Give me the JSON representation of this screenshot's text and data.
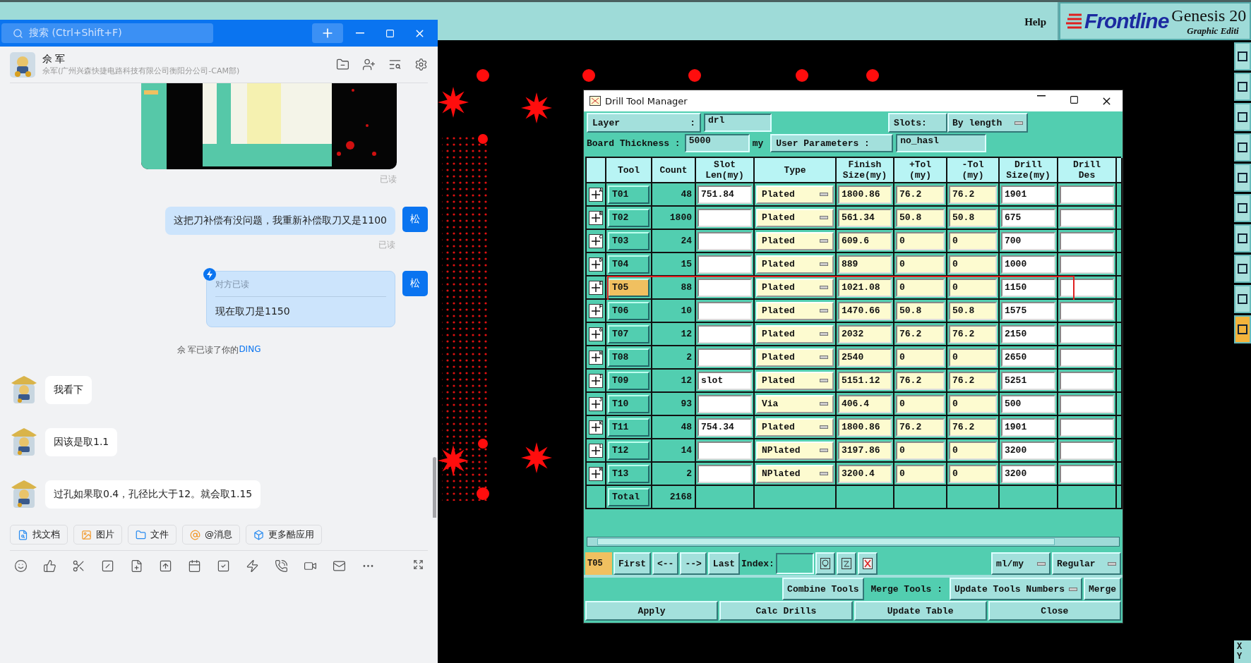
{
  "app_menu": {
    "help": "Help",
    "logo": "Frontline",
    "product": "Genesis 20",
    "subtitle": "Graphic Editi"
  },
  "right_toolbar": {
    "coords": [
      "X",
      "Y"
    ]
  },
  "chat": {
    "search": {
      "placeholder": "搜索 (Ctrl+Shift+F)"
    },
    "contact": {
      "name": "佘 军",
      "detail": "佘军(广州兴森快捷电路科技有限公司衡阳分公司-CAM部)"
    },
    "messages": [
      {
        "kind": "picture",
        "receipt": "已读"
      },
      {
        "kind": "outgoing",
        "text": "这把刀补偿有没问题，我重新补偿取刀又是1100",
        "avatar": "松",
        "receipt": "已读"
      },
      {
        "kind": "ding",
        "status": "对方已读",
        "text": "现在取刀是1150",
        "avatar": "松"
      },
      {
        "kind": "system",
        "text": "佘 军已读了你的",
        "link": "DING"
      },
      {
        "kind": "incoming",
        "text": "我看下"
      },
      {
        "kind": "incoming",
        "text": "因该是取1.1"
      },
      {
        "kind": "incoming",
        "text": "过孔如果取0.4，孔径比大于12。就会取1.15"
      }
    ],
    "quick_actions": [
      "找文档",
      "图片",
      "文件",
      "@消息",
      "更多酷应用"
    ]
  },
  "drill_manager": {
    "title": "Drill Tool Manager",
    "layer": {
      "label": "Layer",
      "colon": ":",
      "value": "drl"
    },
    "slots": {
      "label": "Slots:",
      "value": "By length"
    },
    "thickness": {
      "label": "Board Thickness :",
      "value": "5000",
      "unit": "my"
    },
    "user_params": {
      "label": "User Parameters :",
      "value": "no_hasl"
    },
    "columns": [
      "Tool",
      "Count",
      "Slot\nLen(my)",
      "Type",
      "Finish\nSize(my)",
      "+Tol\n(my)",
      "-Tol\n(my)",
      "Drill\nSize(my)",
      "Drill\nDes"
    ],
    "rows": [
      {
        "letter": "A",
        "tool": "T01",
        "count": "48",
        "slot_len": "751.84",
        "type": "Plated",
        "finish": "1800.86",
        "plus_tol": "76.2",
        "minus_tol": "76.2",
        "drill_size": "1901",
        "selected": false,
        "highlighted": false
      },
      {
        "letter": "B",
        "tool": "T02",
        "count": "1800",
        "type": "Plated",
        "finish": "561.34",
        "plus_tol": "50.8",
        "minus_tol": "50.8",
        "drill_size": "675",
        "selected": false,
        "highlighted": false
      },
      {
        "letter": "C",
        "tool": "T03",
        "count": "24",
        "type": "Plated",
        "finish": "609.6",
        "plus_tol": "0",
        "minus_tol": "0",
        "drill_size": "700",
        "selected": false,
        "highlighted": false
      },
      {
        "letter": "D",
        "tool": "T04",
        "count": "15",
        "type": "Plated",
        "finish": "889",
        "plus_tol": "0",
        "minus_tol": "0",
        "drill_size": "1000",
        "selected": false,
        "highlighted": false
      },
      {
        "letter": "E",
        "tool": "T05",
        "count": "88",
        "type": "Plated",
        "finish": "1021.08",
        "plus_tol": "0",
        "minus_tol": "0",
        "drill_size": "1150",
        "selected": true,
        "highlighted": true
      },
      {
        "letter": "F",
        "tool": "T06",
        "count": "10",
        "type": "Plated",
        "finish": "1470.66",
        "plus_tol": "50.8",
        "minus_tol": "50.8",
        "drill_size": "1575",
        "selected": false,
        "highlighted": false
      },
      {
        "letter": "G",
        "tool": "T07",
        "count": "12",
        "type": "Plated",
        "finish": "2032",
        "plus_tol": "76.2",
        "minus_tol": "76.2",
        "drill_size": "2150",
        "selected": false,
        "highlighted": false
      },
      {
        "letter": "H",
        "tool": "T08",
        "count": "2",
        "type": "Plated",
        "finish": "2540",
        "plus_tol": "0",
        "minus_tol": "0",
        "drill_size": "2650",
        "selected": false,
        "highlighted": false
      },
      {
        "letter": "I",
        "tool": "T09",
        "count": "12",
        "slot_len": "slot",
        "type": "Plated",
        "finish": "5151.12",
        "plus_tol": "76.2",
        "minus_tol": "76.2",
        "drill_size": "5251",
        "selected": false,
        "highlighted": false
      },
      {
        "letter": "J",
        "tool": "T10",
        "count": "93",
        "type": "Via",
        "finish": "406.4",
        "plus_tol": "0",
        "minus_tol": "0",
        "drill_size": "500",
        "selected": false,
        "highlighted": false
      },
      {
        "letter": "K",
        "tool": "T11",
        "count": "48",
        "slot_len": "754.34",
        "type": "Plated",
        "finish": "1800.86",
        "plus_tol": "76.2",
        "minus_tol": "76.2",
        "drill_size": "1901",
        "selected": false,
        "highlighted": false
      },
      {
        "letter": "L",
        "tool": "T12",
        "count": "14",
        "type": "NPlated",
        "finish": "3197.86",
        "plus_tol": "0",
        "minus_tol": "0",
        "drill_size": "3200",
        "selected": false,
        "highlighted": false
      },
      {
        "letter": "M",
        "tool": "T13",
        "count": "2",
        "type": "NPlated",
        "finish": "3200.4",
        "plus_tol": "0",
        "minus_tol": "0",
        "drill_size": "3200",
        "selected": false,
        "highlighted": false
      }
    ],
    "total": {
      "label": "Total",
      "count": "2168"
    },
    "nav": {
      "current": "T05",
      "buttons": [
        "First",
        "<--",
        "-->",
        "Last"
      ],
      "index_label": "Index:",
      "units": "ml/my",
      "mode": "Regular"
    },
    "merge": {
      "combine": "Combine Tools",
      "label": "Merge Tools :",
      "option": "Update Tools Numbers",
      "merge": "Merge"
    },
    "actions": [
      "Apply",
      "Calc Drills",
      "Update Table",
      "Close"
    ]
  }
}
